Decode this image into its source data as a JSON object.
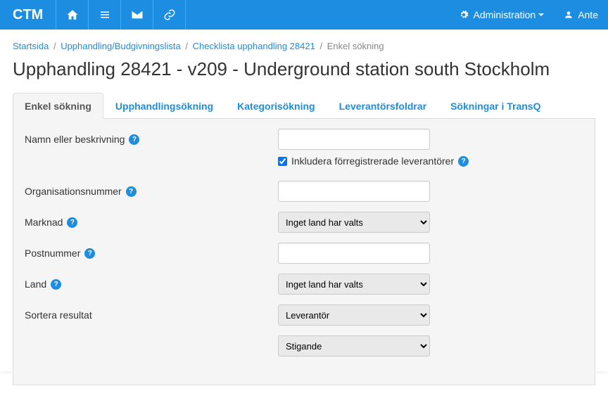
{
  "header": {
    "brand": "CTM",
    "admin_label": "Administration",
    "user_label": "Ante"
  },
  "breadcrumb": {
    "items": [
      "Startsida",
      "Upphandling/Budgivningslista",
      "Checklista upphandling 28421"
    ],
    "current": "Enkel sökning"
  },
  "page_title": "Upphandling  28421 - v209 - Underground station south Stockholm",
  "tabs": [
    "Enkel sökning",
    "Upphandlingsökning",
    "Kategorisökning",
    "Leverantörsfoldrar",
    "Sökningar i TransQ"
  ],
  "form": {
    "name_label": "Namn eller beskrivning",
    "include_prereg_label": "Inkludera förregistrerade leverantörer",
    "org_label": "Organisationsnummer",
    "market_label": "Marknad",
    "market_selected": "Inget land har valts",
    "postal_label": "Postnummer",
    "country_label": "Land",
    "country_selected": "Inget land har valts",
    "sort_label": "Sortera resultat",
    "sort_by_selected": "Leverantör",
    "sort_dir_selected": "Stigande",
    "help_char": "?"
  }
}
